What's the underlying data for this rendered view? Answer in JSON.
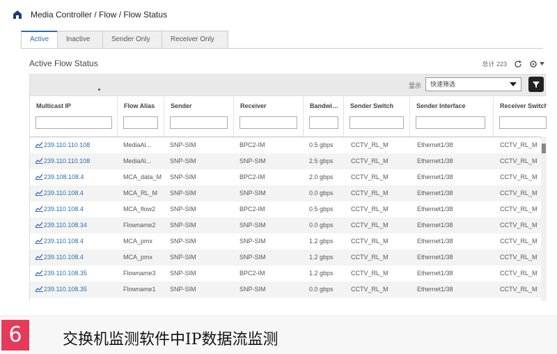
{
  "breadcrumb": "Media Controller / Flow / Flow Status",
  "tabs": [
    {
      "label": "Active",
      "active": true
    },
    {
      "label": "Inactive",
      "active": false
    },
    {
      "label": "Sender Only",
      "active": false
    },
    {
      "label": "Receiver Only",
      "active": false
    }
  ],
  "section_title": "Active Flow Status",
  "header_tools": {
    "count_text": "总计 223"
  },
  "toolbar": {
    "show_label": "显示",
    "select_value": "快速筛选"
  },
  "columns": [
    "Multicast IP",
    "Flow Alias",
    "Sender",
    "Receiver",
    "Bandwi…",
    "Sender Switch",
    "Sender Interface",
    "Receiver Switch"
  ],
  "rows": [
    [
      "239.110.110.108",
      "MediaAl...",
      "SNP-SIM",
      "BPC2-IM",
      "0.5 gbps",
      "CCTV_RL_M",
      "Ethernet1/38",
      "CCTV_RL_M"
    ],
    [
      "239.110.110.108",
      "MediaAl...",
      "SNP-SIM",
      "SNP-SIM",
      "2.5 gbps",
      "CCTV_RL_M",
      "Ethernet1/38",
      "CCTV_RL_M"
    ],
    [
      "239.108.108.4",
      "MCA_data_M",
      "SNP-SIM",
      "BPC2-IM",
      "2.0 gbps",
      "CCTV_RL_M",
      "Ethernet1/38",
      "CCTV_RL_M"
    ],
    [
      "239.110.108.4",
      "MCA_RL_M",
      "SNP-SIM",
      "SNP-SIM",
      "0.0 gbps",
      "CCTV_RL_M",
      "Ethernet1/38",
      "CCTV_RL_M"
    ],
    [
      "239.110.108.4",
      "MCA_flow2",
      "SNP-SIM",
      "BPC2-IM",
      "0.5 gbps",
      "CCTV_RL_M",
      "Ethernet1/38",
      "CCTV_RL_M"
    ],
    [
      "239.110.108.34",
      "Flowname2",
      "SNP-SIM",
      "SNP-SIM",
      "0.0 gbps",
      "CCTV_RL_M",
      "Ethernet1/38",
      "CCTV_RL_M"
    ],
    [
      "239.110.108.4",
      "MCA_pmx",
      "SNP-SIM",
      "SNP-SIM",
      "1.2 gbps",
      "CCTV_RL_M",
      "Ethernet1/38",
      "CCTV_RL_M"
    ],
    [
      "239.110.108.4",
      "MCA_pmx",
      "SNP-SIM",
      "SNP-SIM",
      "1.2 gbps",
      "CCTV_RL_M",
      "Ethernet1/38",
      "CCTV_RL_M"
    ],
    [
      "239.110.108.35",
      "Flowname3",
      "SNP-SIM",
      "BPC2-IM",
      "1.2 gbps",
      "CCTV_RL_M",
      "Ethernet1/38",
      "CCTV_RL_M"
    ],
    [
      "239.110.108.35",
      "Flowname1",
      "SNP-SIM",
      "SNP-SIM",
      "0.0 gbps",
      "CCTV_RL_M",
      "Ethernet1/38",
      "CCTV_RL_M"
    ]
  ],
  "caption": {
    "number": "6",
    "text": "交换机监测软件中IP数据流监测"
  },
  "colors": {
    "accent": "#2a6db0",
    "badge": "#e63a5a"
  }
}
